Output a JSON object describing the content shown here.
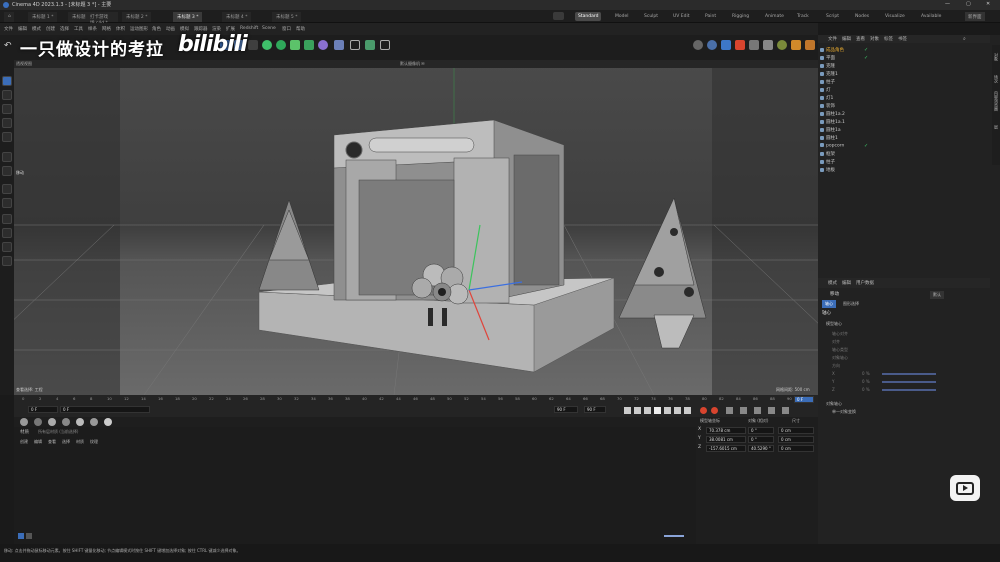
{
  "titlebar": {
    "title": "Cinema 4D 2023.1.3 - [未标题 3 *] - 主要",
    "minimize": "—",
    "maximize": "▢",
    "close": "✕"
  },
  "doc_tabs": [
    {
      "label": "未标题 1 *",
      "active": false
    },
    {
      "label": "未标题 2 *",
      "active": false
    },
    {
      "label": "打卡游戏场.c4d *",
      "active": false
    },
    {
      "label": "未标题 2 *",
      "active": false
    },
    {
      "label": "未标题 3 *",
      "active": true
    },
    {
      "label": "未标题 4 *",
      "active": false
    },
    {
      "label": "未标题 5 *",
      "active": false
    }
  ],
  "layouts": [
    "Standard",
    "Model",
    "Sculpt",
    "UV Edit",
    "Paint",
    "Rigging",
    "Animate",
    "Track",
    "Script",
    "Nodes",
    "Visualize",
    "Available"
  ],
  "new_layout": "新界面",
  "menus": [
    "文件",
    "编辑",
    "模式",
    "创建",
    "选择",
    "工具",
    "样条",
    "网格",
    "体积",
    "运动图形",
    "角色",
    "动画",
    "模拟",
    "跟踪器",
    "渲染",
    "扩展",
    "Redshift",
    "Scene",
    "窗口",
    "帮助"
  ],
  "watermark": {
    "text": "一只做设计的考拉",
    "logo": "bilibili"
  },
  "viewport": {
    "label": "透视视图",
    "camera": "默认摄像机 ✉",
    "move_label": "移动",
    "footer_left": "查看选择: 工程",
    "footer_right": "网格间距: 500 cm"
  },
  "timeline": {
    "ticks": [
      "0",
      "2",
      "4",
      "6",
      "8",
      "10",
      "12",
      "14",
      "16",
      "18",
      "20",
      "22",
      "24",
      "26",
      "28",
      "30",
      "32",
      "34",
      "36",
      "38",
      "40",
      "42",
      "44",
      "46",
      "48",
      "50",
      "52",
      "54",
      "56",
      "58",
      "60",
      "62",
      "64",
      "66",
      "68",
      "70",
      "72",
      "74",
      "76",
      "78",
      "80",
      "82",
      "84",
      "86",
      "88",
      "90"
    ],
    "start": "0 F",
    "current": "0 F",
    "end_a": "90 F",
    "end_b": "90 F",
    "frame_badge": "0 F"
  },
  "material_manager": {
    "tabs": [
      "材质"
    ],
    "menus": [
      "创建",
      "编辑",
      "查看",
      "选择",
      "材质",
      "纹理"
    ],
    "filter": "所有层材质 (当前选择)",
    "material_count": 7
  },
  "coordinates": {
    "header": [
      "位置",
      "尺寸",
      "旋转"
    ],
    "mode_a": "模型轴坐标",
    "mode_b": "对象 (相对)",
    "mode_c": "尺寸",
    "rows": [
      {
        "axis": "X",
        "pos": "70.378 cm",
        "rot": "0 °",
        "size": "0 cm"
      },
      {
        "axis": "Y",
        "pos": "38.0081 cm",
        "rot": "0 °",
        "size": "0 cm"
      },
      {
        "axis": "Z",
        "pos": "-157.6015 cm",
        "rot": "40.5290 °",
        "size": "0 cm"
      }
    ],
    "apply": "应用"
  },
  "object_manager": {
    "tabs": [
      "文件",
      "编辑",
      "查看",
      "对象",
      "标签",
      "书签"
    ],
    "objects": [
      {
        "name": "成品角色",
        "highlight": true,
        "checked": true
      },
      {
        "name": "平面",
        "checked": true
      },
      {
        "name": "克隆",
        "checked": false
      },
      {
        "name": "克隆1",
        "checked": false
      },
      {
        "name": "柱子",
        "checked": false
      },
      {
        "name": "灯",
        "checked": false
      },
      {
        "name": "灯1",
        "checked": false
      },
      {
        "name": "装饰",
        "checked": false
      },
      {
        "name": "圆柱1a.2",
        "checked": false
      },
      {
        "name": "圆柱1a.1",
        "checked": false
      },
      {
        "name": "圆柱1a",
        "checked": false
      },
      {
        "name": "圆柱1",
        "checked": false
      },
      {
        "name": "popcorn",
        "checked": true
      },
      {
        "name": "框架",
        "checked": false
      },
      {
        "name": "柱子",
        "checked": false
      },
      {
        "name": "地板",
        "checked": false
      }
    ]
  },
  "attributes": {
    "tabs": [
      "模式",
      "编辑",
      "用户数据"
    ],
    "title": "移动",
    "subtabs": [
      "轴心",
      "图形选择"
    ],
    "section": "轴心",
    "subsection": "模型轴心",
    "fields": [
      "轴心对齐",
      "对齐",
      "轴心类型",
      "对象轴心",
      "方向"
    ],
    "vec_labels": [
      "X",
      "Y",
      "Z"
    ],
    "vec_values": [
      "0 %",
      "0 %",
      "0 %"
    ],
    "section2": "对象轴心",
    "option": "单一对象变换",
    "dropdown": "默认"
  },
  "side_tabs": [
    "对象",
    "场次",
    "内容浏览器",
    "层"
  ],
  "statusbar": "移动: 点击并拖动鼠标移动元素。按住 SHIFT 键量化移动; 节点编辑模式时按住 SHIFT 键增加选择对象; 按住 CTRL 键减少选择对象。"
}
